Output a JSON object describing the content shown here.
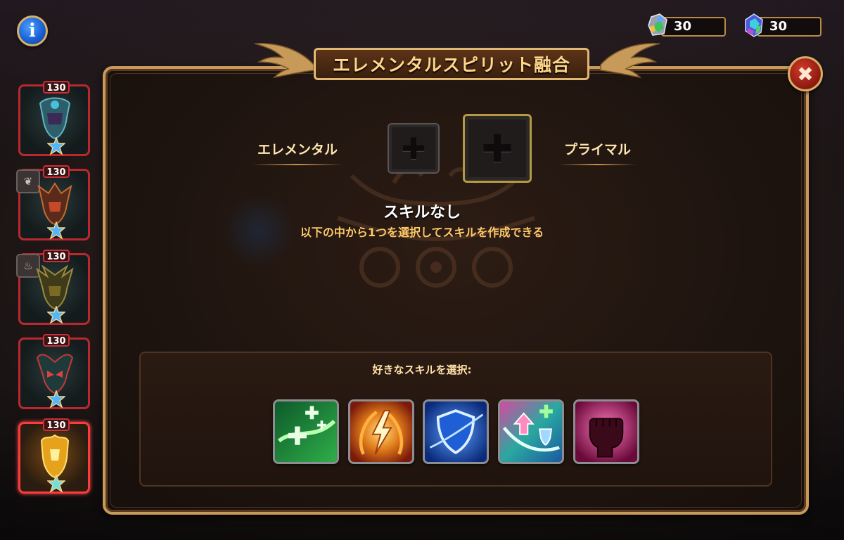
{
  "header": {
    "title": "エレメンタルスピリット融合",
    "info_icon": "i"
  },
  "currencies": [
    {
      "icon": "elemental-crystal-icon",
      "amount": "30"
    },
    {
      "icon": "primal-crystal-icon",
      "amount": "30"
    }
  ],
  "heroes": [
    {
      "level": "130",
      "element_icon": "",
      "selected": false
    },
    {
      "level": "130",
      "element_icon": "leaf-icon",
      "selected": false
    },
    {
      "level": "130",
      "element_icon": "fire-icon",
      "selected": false
    },
    {
      "level": "130",
      "element_icon": "",
      "selected": false
    },
    {
      "level": "130",
      "element_icon": "",
      "selected": true
    }
  ],
  "fusion": {
    "left_label": "エレメンタル",
    "right_label": "プライマル",
    "skill_title": "スキルなし",
    "skill_description": "以下の中から1つを選択してスキルを作成できる"
  },
  "skills": {
    "prompt": "好きなスキルを選択:",
    "items": [
      {
        "icon": "healing-icon",
        "color": "#2fae4a"
      },
      {
        "icon": "lightning-burst-icon",
        "color": "#e07a1a"
      },
      {
        "icon": "shield-icon",
        "color": "#1f5fd6"
      },
      {
        "icon": "buff-heal-icon",
        "color": "#2aa8a0"
      },
      {
        "icon": "fist-icon",
        "color": "#c4337a"
      }
    ]
  },
  "colors": {
    "frame_gold": "#c79a5a",
    "title_text": "#ffd68a",
    "description_text": "#ffc96a",
    "hero_border": "#b9282d"
  }
}
